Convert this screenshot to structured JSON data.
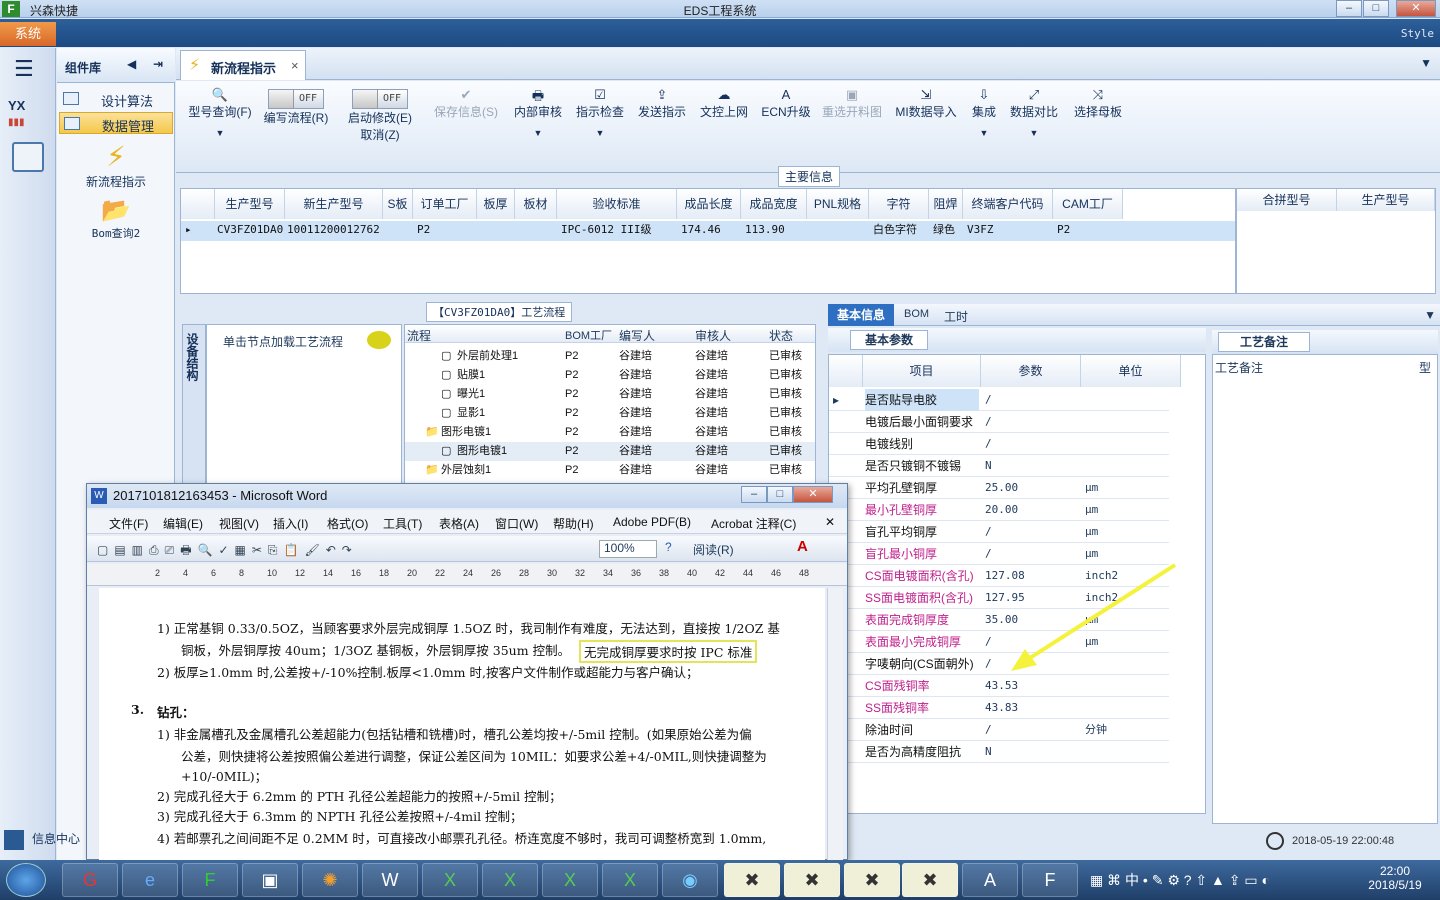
{
  "app": {
    "short_name": "兴森快捷",
    "window_title": "EDS工程系统",
    "system_button": "系统",
    "style_label": "Style"
  },
  "component_panel": {
    "title": "组件库",
    "items": [
      "设计算法",
      "数据管理"
    ],
    "big_buttons": [
      "新流程指示",
      "Bom查询2"
    ]
  },
  "doc_tab": {
    "label": "新流程指示"
  },
  "ribbon": {
    "buttons": [
      {
        "label": "型号查询(F)",
        "icon": "search-icon"
      },
      {
        "label": "编写流程(R)",
        "toggle": "OFF"
      },
      {
        "label": "启动修改(E)",
        "label2": "取消(Z)",
        "toggle": "OFF"
      },
      {
        "label": "保存信息(S)",
        "icon": "check-icon",
        "disabled": true
      },
      {
        "label": "内部审核",
        "icon": "printer-icon"
      },
      {
        "label": "指示检查",
        "icon": "checkbox-icon"
      },
      {
        "label": "发送指示",
        "icon": "upload-icon"
      },
      {
        "label": "文控上网",
        "icon": "cloud-upload-icon"
      },
      {
        "label": "ECN升级",
        "icon": "ecn-icon"
      },
      {
        "label": "重选开料图",
        "icon": "image-icon",
        "disabled": true
      },
      {
        "label": "MI数据导入",
        "icon": "import-icon"
      },
      {
        "label": "集成",
        "icon": "download-icon"
      },
      {
        "label": "数据对比",
        "icon": "compare-icon"
      },
      {
        "label": "选择母板",
        "icon": "shuffle-icon"
      }
    ]
  },
  "main_info": {
    "title": "主要信息",
    "columns": [
      "生产型号",
      "新生产型号",
      "S板",
      "订单工厂",
      "板厚",
      "板材",
      "验收标准",
      "成品长度",
      "成品宽度",
      "PNL规格",
      "字符",
      "阻焊",
      "终端客户代码",
      "CAM工厂"
    ],
    "row": [
      "CV3FZ01DA0",
      "10011200012762",
      "",
      "P2",
      "",
      "",
      "IPC-6012 III级",
      "174.46",
      "113.90",
      "",
      "白色字符",
      "绿色",
      "V3FZ",
      "P2"
    ],
    "side_columns": [
      "合拼型号",
      "生产型号"
    ]
  },
  "process_flow": {
    "title": "【CV3FZ01DA0】工艺流程",
    "side_tab": "设备结构",
    "hint": "单击节点加载工艺流程",
    "columns": [
      "流程",
      "BOM工厂",
      "编写人",
      "审核人",
      "状态"
    ],
    "rows": [
      {
        "name": "外层前处理1",
        "bom": "P2",
        "writer": "谷建培",
        "reviewer": "谷建培",
        "status": "已审核"
      },
      {
        "name": "贴膜1",
        "bom": "P2",
        "writer": "谷建培",
        "reviewer": "谷建培",
        "status": "已审核"
      },
      {
        "name": "曝光1",
        "bom": "P2",
        "writer": "谷建培",
        "reviewer": "谷建培",
        "status": "已审核"
      },
      {
        "name": "显影1",
        "bom": "P2",
        "writer": "谷建培",
        "reviewer": "谷建培",
        "status": "已审核"
      },
      {
        "name": "图形电镀1",
        "bom": "P2",
        "writer": "谷建培",
        "reviewer": "谷建培",
        "status": "已审核"
      },
      {
        "name": "图形电镀1",
        "bom": "P2",
        "writer": "谷建培",
        "reviewer": "谷建培",
        "status": "已审核"
      },
      {
        "name": "外层蚀刻1",
        "bom": "P2",
        "writer": "谷建培",
        "reviewer": "谷建培",
        "status": "已审核"
      }
    ]
  },
  "basic_info": {
    "tabs": [
      "基本信息",
      "BOM",
      "工时"
    ],
    "subtab": "基本参数",
    "columns": [
      "项目",
      "参数",
      "单位"
    ],
    "rows": [
      {
        "item": "是否贴导电胶",
        "value": "/",
        "unit": "",
        "red": false
      },
      {
        "item": "电镀后最小面铜要求",
        "value": "/",
        "unit": "",
        "red": false
      },
      {
        "item": "电镀线别",
        "value": "/",
        "unit": "",
        "red": false
      },
      {
        "item": "是否只镀铜不镀锡",
        "value": "N",
        "unit": "",
        "red": false
      },
      {
        "item": "平均孔壁铜厚",
        "value": "25.00",
        "unit": "μm",
        "red": false
      },
      {
        "item": "最小孔壁铜厚",
        "value": "20.00",
        "unit": "μm",
        "red": true
      },
      {
        "item": "盲孔平均铜厚",
        "value": "/",
        "unit": "μm",
        "red": false
      },
      {
        "item": "盲孔最小铜厚",
        "value": "/",
        "unit": "μm",
        "red": true
      },
      {
        "item": "CS面电镀面积(含孔)",
        "value": "127.08",
        "unit": "inch2",
        "red": true
      },
      {
        "item": "SS面电镀面积(含孔)",
        "value": "127.95",
        "unit": "inch2",
        "red": true
      },
      {
        "item": "表面完成铜厚度",
        "value": "35.00",
        "unit": "μm",
        "red": true
      },
      {
        "item": "表面最小完成铜厚",
        "value": "/",
        "unit": "μm",
        "red": true
      },
      {
        "item": "字唛朝向(CS面朝外)",
        "value": "/",
        "unit": "",
        "red": false
      },
      {
        "item": "CS面残铜率",
        "value": "43.53",
        "unit": "",
        "red": true
      },
      {
        "item": "SS面残铜率",
        "value": "43.83",
        "unit": "",
        "red": true
      },
      {
        "item": "除油时间",
        "value": "/",
        "unit": "分钟",
        "red": false
      },
      {
        "item": "是否为高精度阻抗",
        "value": "N",
        "unit": "",
        "red": false
      }
    ]
  },
  "process_notes": {
    "tab": "工艺备注",
    "column": "工艺备注",
    "column2": "型"
  },
  "status": {
    "timestamp": "2018-05-19 22:00:48",
    "info_center": "信息中心"
  },
  "word": {
    "title": "2017101812163453 - Microsoft Word",
    "menus": [
      "文件(F)",
      "编辑(E)",
      "视图(V)",
      "插入(I)",
      "格式(O)",
      "工具(T)",
      "表格(A)",
      "窗口(W)",
      "帮助(H)",
      "Adobe PDF(B)",
      "Acrobat 注释(C)"
    ],
    "zoom": "100%",
    "read_mode": "阅读(R)",
    "ruler": [
      "2",
      "4",
      "6",
      "8",
      "10",
      "12",
      "14",
      "16",
      "18",
      "20",
      "22",
      "24",
      "26",
      "28",
      "30",
      "32",
      "34",
      "36",
      "38",
      "40",
      "42",
      "44",
      "46",
      "48"
    ],
    "lines": [
      "1)  正常基铜 0.33/0.5OZ，当顾客要求外层完成铜厚 1.5OZ 时，我司制作有难度，无法达到，直接按 1/2OZ 基",
      "铜板，外层铜厚按 40um；1/3OZ 基铜板，外层铜厚按 35um 控制。",
      "无完成铜厚要求时按 IPC 标准",
      "2)  板厚≥1.0mm 时,公差按+/-10%控制.板厚<1.0mm 时,按客户文件制作或超能力与客户确认；",
      "3.",
      "钻孔：",
      "1)  非金属槽孔及金属槽孔公差超能力(包括钻槽和铣槽)时，槽孔公差均按+/-5mil 控制。(如果原始公差为偏",
      "公差，则快捷将公差按照偏公差进行调整，保证公差区间为 10MIL：如要求公差+4/-0MIL,则快捷调整为",
      "+10/-0MIL)；",
      "2)  完成孔径大于 6.2mm 的 PTH 孔径公差超能力的按照+/-5mil 控制；",
      "3)  完成孔径大于 6.3mm 的 NPTH 孔径公差按照+/-4mil 控制；",
      "4)  若邮票孔之间间距不足 0.2MM 时，可直接改小邮票孔孔径。桥连宽度不够时，我司可调整桥宽到 1.0mm,"
    ]
  },
  "taskbar": {
    "ime": "中",
    "time": "22:00",
    "date": "2018/5/19"
  }
}
